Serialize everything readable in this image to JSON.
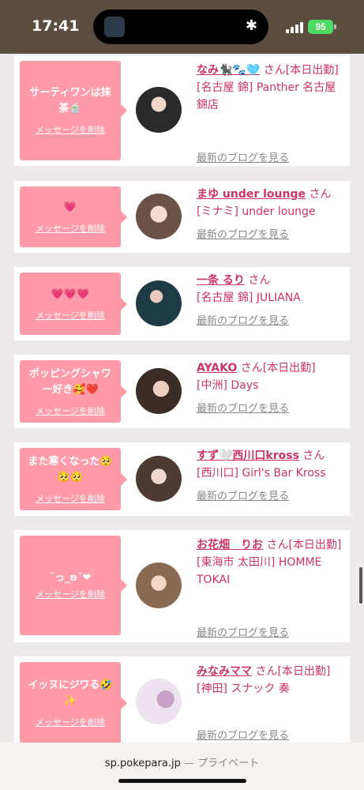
{
  "status_bar": {
    "time": "17:41",
    "battery": "95"
  },
  "items": [
    {
      "message": "サーティワンは抹茶🍵",
      "delete": "メッセージを削除",
      "name": "なみ🐈‍⬛🐾🩵",
      "san": "さん",
      "tag": "[本日出勤]",
      "shop": "[名古屋 錦] Panther 名古屋錦店",
      "blog": "最新のブログを見る"
    },
    {
      "message": "💗",
      "delete": "メッセージを削除",
      "name": "まゆ under lounge",
      "san": "さん",
      "tag": "",
      "shop": "[ミナミ] under lounge",
      "blog": "最新のブログを見る"
    },
    {
      "message": "💗💗💗",
      "delete": "メッセージを削除",
      "name": "一条 るり",
      "san": "さん",
      "tag": "",
      "shop": "[名古屋 錦] JULIANA",
      "blog": "最新のブログを見る"
    },
    {
      "message": "ポッピングシャワー好き🥰❤️",
      "delete": "メッセージを削除",
      "name": "AYAKO",
      "san": "さん",
      "tag": "[本日出勤]",
      "shop": "[中洲] Days",
      "blog": "最新のブログを見る"
    },
    {
      "message": "また寒くなった🥺🥺🥺",
      "delete": "メッセージを削除",
      "name": "すず🤍西川口kross",
      "san": "さん",
      "tag": "",
      "shop": "[西川口] Girl's Bar Kross",
      "blog": "最新のブログを見る"
    },
    {
      "message": "˘っ_ʚ˘❤",
      "delete": "メッセージを削除",
      "name": "お花畑　りお",
      "san": "さん",
      "tag": "[本日出勤]",
      "shop": "[東海市 太田川] HOMME TOKAI",
      "blog": "最新のブログを見る"
    },
    {
      "message": "イッヌにジワる🤣✨",
      "delete": "メッセージを削除",
      "name": "みなみママ",
      "san": "さん",
      "tag": "[本日出勤]",
      "shop": "[神田] スナック 奏",
      "blog": "最新のブログを見る"
    }
  ],
  "browser": {
    "domain": "sp.pokepara.jp",
    "separator": "—",
    "mode": "プライベート"
  }
}
